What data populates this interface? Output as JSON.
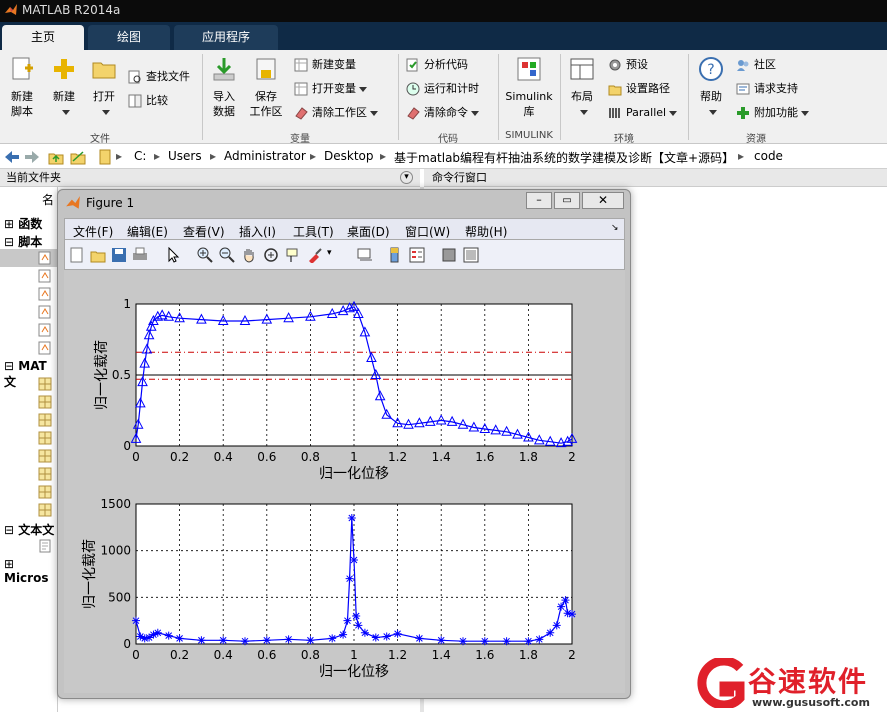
{
  "app": {
    "title": "MATLAB R2014a"
  },
  "tabs": [
    {
      "label": "主页",
      "active": true
    },
    {
      "label": "绘图",
      "active": false
    },
    {
      "label": "应用程序",
      "active": false
    }
  ],
  "ribbon": {
    "groups": {
      "file": "文件",
      "variable": "变量",
      "code": "代码",
      "simulink": "SIMULINK",
      "env": "环境",
      "resources": "资源"
    },
    "new_script": "新建\n脚本",
    "new_script_l1": "新建",
    "new_script_l2": "脚本",
    "new": "新建",
    "open": "打开",
    "find_files": "查找文件",
    "compare": "比较",
    "import_l1": "导入",
    "import_l2": "数据",
    "save_l1": "保存",
    "save_l2": "工作区",
    "new_var": "新建变量",
    "open_var": "打开变量",
    "clear_ws": "清除工作区",
    "analyze": "分析代码",
    "run_time": "运行和计时",
    "clear_cmd": "清除命令",
    "simulink_l1": "Simulink",
    "simulink_l2": "库",
    "layout": "布局",
    "prefs": "预设",
    "set_path": "设置路径",
    "parallel": "Parallel",
    "help": "帮助",
    "community": "社区",
    "request_support": "请求支持",
    "addons": "附加功能"
  },
  "address": {
    "crumbs": [
      "C:",
      "Users",
      "Administrator",
      "Desktop",
      "基于matlab编程有杆抽油系统的数学建模及诊断【文章+源码】",
      "code"
    ]
  },
  "panels": {
    "current_folder": "当前文件夹",
    "command_window": "命令行窗口",
    "tree": [
      "函数",
      "脚本",
      "MAT 文",
      "文本文",
      "Micros"
    ],
    "name_col": "名"
  },
  "figure": {
    "title": "Figure 1",
    "menus": [
      "文件(F)",
      "编辑(E)",
      "查看(V)",
      "插入(I)",
      "工具(T)",
      "桌面(D)",
      "窗口(W)",
      "帮助(H)"
    ]
  },
  "chart_data": [
    {
      "type": "line",
      "xlabel": "归一化位移",
      "ylabel": "归一化载荷",
      "xlim": [
        0,
        2
      ],
      "ylim": [
        0,
        1
      ],
      "xticks": [
        "0",
        "0.2",
        "0.4",
        "0.6",
        "0.8",
        "1",
        "1.2",
        "1.4",
        "1.6",
        "1.8",
        "2"
      ],
      "yticks": [
        "0",
        "0.5",
        "1"
      ],
      "grid": true,
      "colors": {
        "series": "#0000ff",
        "ref": "#cc0000",
        "mid": "#000000"
      },
      "series": [
        {
          "marker": "triangle",
          "x": [
            0,
            0.01,
            0.02,
            0.03,
            0.04,
            0.05,
            0.06,
            0.07,
            0.08,
            0.1,
            0.12,
            0.15,
            0.2,
            0.3,
            0.4,
            0.5,
            0.6,
            0.7,
            0.8,
            0.9,
            0.95,
            0.98,
            1.0,
            1.02,
            1.05,
            1.08,
            1.1,
            1.12,
            1.15,
            1.2,
            1.25,
            1.3,
            1.35,
            1.4,
            1.45,
            1.5,
            1.55,
            1.6,
            1.65,
            1.7,
            1.75,
            1.8,
            1.85,
            1.9,
            1.95,
            1.98,
            2.0
          ],
          "y": [
            0.05,
            0.15,
            0.3,
            0.45,
            0.58,
            0.68,
            0.78,
            0.84,
            0.88,
            0.91,
            0.92,
            0.91,
            0.9,
            0.89,
            0.88,
            0.88,
            0.89,
            0.9,
            0.91,
            0.93,
            0.95,
            0.97,
            0.98,
            0.93,
            0.8,
            0.62,
            0.5,
            0.35,
            0.22,
            0.16,
            0.15,
            0.16,
            0.17,
            0.18,
            0.17,
            0.15,
            0.13,
            0.12,
            0.11,
            0.1,
            0.08,
            0.06,
            0.04,
            0.03,
            0.02,
            0.03,
            0.05
          ]
        }
      ],
      "refs": [
        0.66,
        0.47,
        0.5
      ]
    },
    {
      "type": "line",
      "xlabel": "归一化位移",
      "ylabel": "归一化载荷",
      "xlim": [
        0,
        2
      ],
      "ylim": [
        0,
        1500
      ],
      "xticks": [
        "0",
        "0.2",
        "0.4",
        "0.6",
        "0.8",
        "1",
        "1.2",
        "1.4",
        "1.6",
        "1.8",
        "2"
      ],
      "yticks": [
        "0",
        "500",
        "1000",
        "1500"
      ],
      "grid": true,
      "colors": {
        "series": "#0000ff"
      },
      "series": [
        {
          "marker": "star",
          "x": [
            0,
            0.02,
            0.04,
            0.06,
            0.08,
            0.1,
            0.15,
            0.2,
            0.3,
            0.4,
            0.5,
            0.6,
            0.7,
            0.8,
            0.9,
            0.95,
            0.97,
            0.98,
            0.99,
            1.0,
            1.01,
            1.02,
            1.05,
            1.1,
            1.15,
            1.2,
            1.3,
            1.4,
            1.5,
            1.6,
            1.7,
            1.8,
            1.85,
            1.9,
            1.93,
            1.95,
            1.97,
            1.98,
            2.0
          ],
          "y": [
            250,
            80,
            60,
            70,
            100,
            120,
            90,
            60,
            40,
            40,
            30,
            40,
            50,
            40,
            60,
            100,
            250,
            700,
            1350,
            900,
            300,
            200,
            120,
            70,
            80,
            110,
            60,
            40,
            30,
            30,
            30,
            30,
            50,
            120,
            200,
            400,
            470,
            330,
            320
          ]
        }
      ]
    }
  ],
  "watermark": {
    "brand": "谷速软件",
    "url": "www.gususoft.com",
    "color": "#e0202a"
  }
}
